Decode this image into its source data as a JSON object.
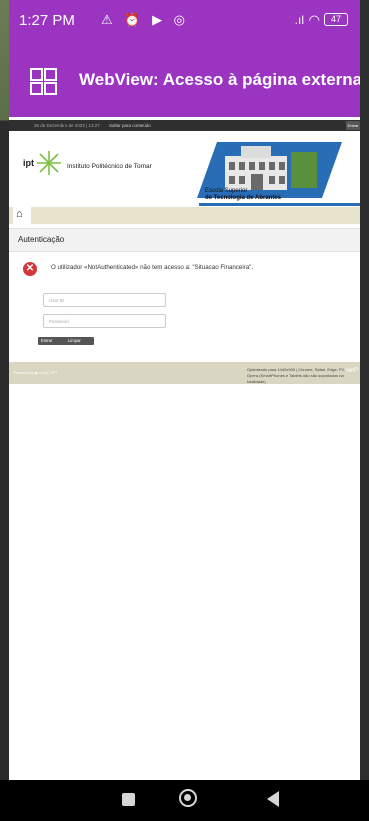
{
  "status_bar": {
    "time": "1:27 PM",
    "icons": "⚠ ⏰ ▶ ◎",
    "signal": ".ıl",
    "battery": "47"
  },
  "app_bar": {
    "title": "WebView: Acesso à página externa."
  },
  "site": {
    "topbar_date": "26 de Dezembro de 2023 | 13:27",
    "topbar_skip": "Saltar para conteúdo",
    "topbar_right": "Entrar",
    "brand_mark": "ipt",
    "institute_name": "Instituto Politécnico de Tomar",
    "school_line1": "Escola Superior",
    "school_line2": "de Tecnologia de Abrantes",
    "section_title": "Autenticação",
    "error_message": "O utilizador «NotAuthenticated» não tem acesso a: \"Situacao Financeira\".",
    "user_placeholder": "User ID",
    "password_placeholder": "Password",
    "enter_button": "Entrar",
    "clear_button": "Limpar",
    "footer_left": "Powered by  ▶  netQ | IPT",
    "footer_right": "Optimizado para 1440x900 | Chrome, Safari, Edge, FX, Opera (SmartPhones e Tablets não são suportados na totalidade)",
    "footer_brand": "netP"
  }
}
